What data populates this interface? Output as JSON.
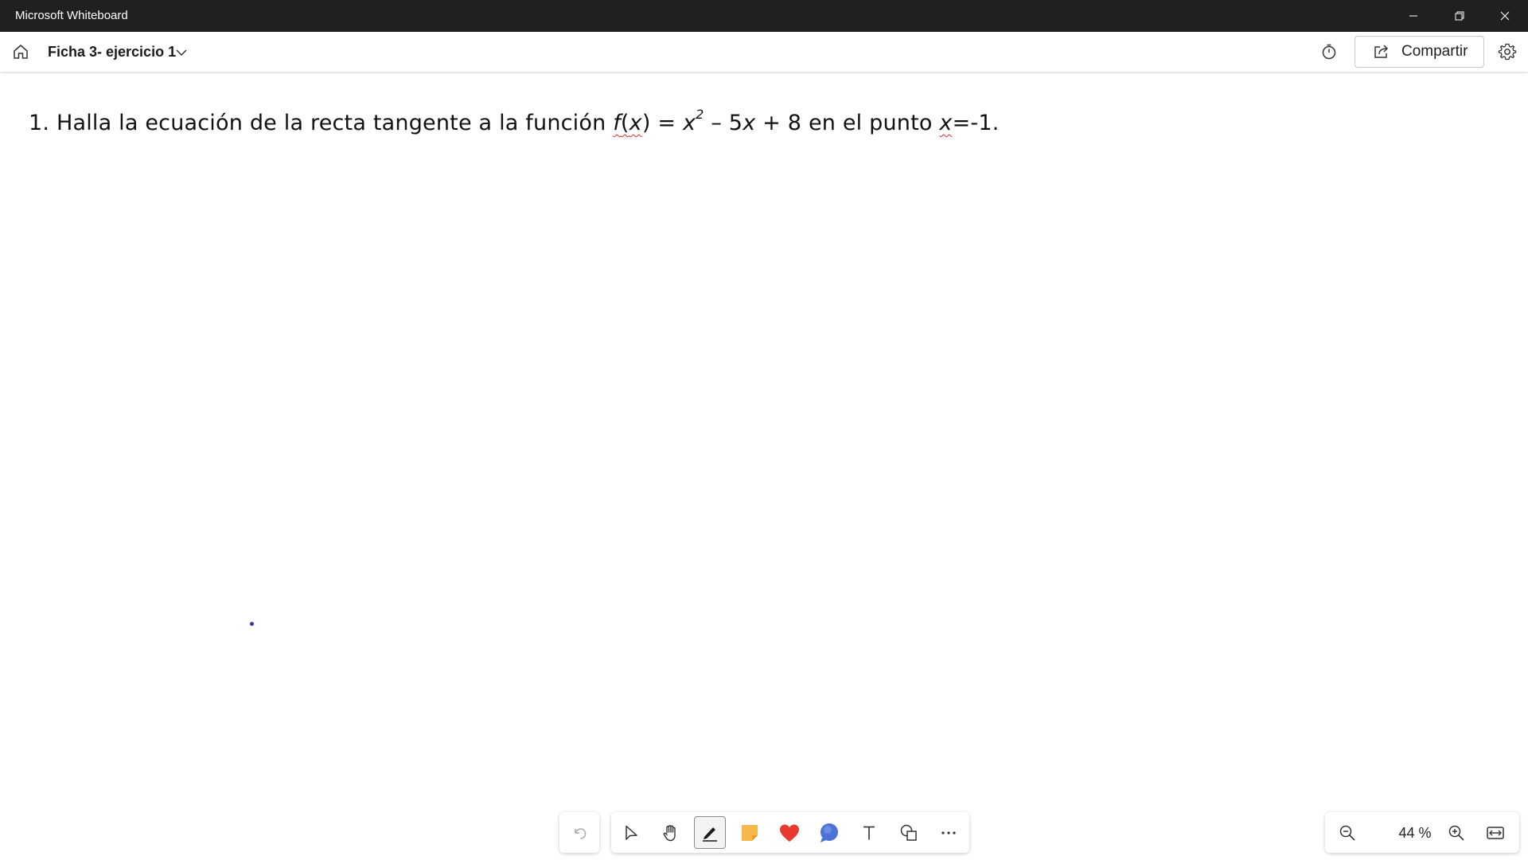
{
  "window": {
    "app_title": "Microsoft Whiteboard"
  },
  "header": {
    "board_title": "Ficha 3- ejercicio 1",
    "share_label": "Compartir"
  },
  "canvas": {
    "problem": {
      "prefix": "1. Halla la ecuación de la recta tangente a la función ",
      "f": "f",
      "open_paren": "(",
      "x1": "x",
      "close_eq": ") = ",
      "x2": "x",
      "exponent": "2",
      "middle": " – 5",
      "x3": "x",
      "after": " + 8 en el punto ",
      "x4": "x",
      "end": "=-1."
    }
  },
  "zoom": {
    "level": "44 %"
  },
  "colors": {
    "titlebar": "#202020",
    "sticky": "#f7b84b",
    "heart": "#e8392f",
    "comment": "#4a72d9",
    "ink": "#3a3a9a"
  },
  "icons": {
    "home": "home-icon",
    "chevron": "chevron-down-icon",
    "timer": "timer-icon",
    "share": "share-icon",
    "settings": "gear-icon",
    "undo": "undo-icon",
    "select": "select-pointer-icon",
    "pan": "hand-icon",
    "pen": "pen-icon",
    "sticky": "sticky-note-icon",
    "reaction": "heart-icon",
    "comment": "comment-icon",
    "text": "text-icon",
    "shapes": "shapes-icon",
    "more": "more-icon",
    "zoom_out": "zoom-out-icon",
    "zoom_in": "zoom-in-icon",
    "fit": "fit-to-screen-icon"
  }
}
